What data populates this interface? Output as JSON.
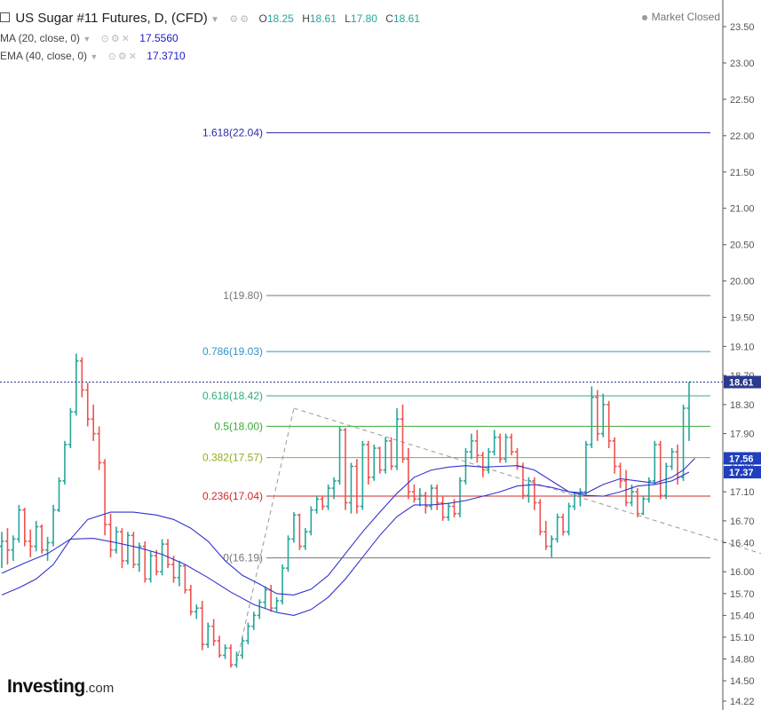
{
  "header": {
    "symbol": "US Sugar #11 Futures, D, (CFD)",
    "o_label": "O",
    "o_val": "18.25",
    "h_label": "H",
    "h_val": "18.61",
    "l_label": "L",
    "l_val": "17.80",
    "c_label": "C",
    "c_val": "18.61",
    "status": "Market Closed"
  },
  "indicators": [
    {
      "name": "MA (20, close, 0)",
      "value": "17.5560",
      "color": "#3333cc"
    },
    {
      "name": "EMA (40, close, 0)",
      "value": "17.3710",
      "color": "#3333cc"
    }
  ],
  "logo": {
    "main": "Investing",
    "suffix": ".com"
  },
  "chart_data": {
    "type": "ohlc",
    "y_axis": {
      "min": 14.2,
      "max": 23.7,
      "ticks": [
        "23.50",
        "23.00",
        "22.50",
        "22.00",
        "21.50",
        "21.00",
        "20.50",
        "20.00",
        "19.50",
        "19.10",
        "18.70",
        "18.30",
        "17.90",
        "17.50",
        "17.10",
        "16.70",
        "16.40",
        "16.00",
        "15.70",
        "15.40",
        "15.10",
        "14.80",
        "14.50",
        "14.22"
      ]
    },
    "price_badges": [
      {
        "label": "18.61",
        "value": 18.61,
        "color": "#2b3a8f"
      },
      {
        "label": "17.56",
        "value": 17.56,
        "color": "#1f3fbf"
      },
      {
        "label": "17.37",
        "value": 17.37,
        "color": "#1f3fbf"
      }
    ],
    "last_price": 18.61,
    "fib_levels": [
      {
        "label": "1.618(22.04)",
        "value": 22.04,
        "color": "#2a2aa8"
      },
      {
        "label": "1(19.80)",
        "value": 19.8,
        "color": "#777777"
      },
      {
        "label": "0.786(19.03)",
        "value": 19.03,
        "color": "#2e96c8"
      },
      {
        "label": "0.618(18.42)",
        "value": 18.42,
        "color": "#2eb07a"
      },
      {
        "label": "0.5(18.00)",
        "value": 18.0,
        "color": "#3aaa3a"
      },
      {
        "label": "0.382(17.57)",
        "value": 17.57,
        "color": "#8fb020"
      },
      {
        "label": "0.236(17.04)",
        "value": 17.04,
        "color": "#cc2a2a"
      },
      {
        "label": "0(16.19)",
        "value": 16.19,
        "color": "#777777"
      }
    ],
    "up_color": "#26a69a",
    "down_color": "#ef5350",
    "ohlc": [
      [
        16.35,
        16.55,
        16.05,
        16.42
      ],
      [
        16.42,
        16.6,
        16.1,
        16.3
      ],
      [
        16.3,
        16.5,
        16.15,
        16.45
      ],
      [
        16.45,
        16.92,
        16.4,
        16.85
      ],
      [
        16.85,
        16.88,
        16.35,
        16.42
      ],
      [
        16.42,
        16.58,
        16.2,
        16.35
      ],
      [
        16.35,
        16.7,
        16.28,
        16.62
      ],
      [
        16.62,
        16.65,
        16.25,
        16.3
      ],
      [
        16.3,
        16.48,
        16.15,
        16.4
      ],
      [
        16.4,
        16.92,
        16.35,
        16.85
      ],
      [
        16.85,
        17.3,
        16.82,
        17.25
      ],
      [
        17.25,
        17.8,
        17.2,
        17.75
      ],
      [
        17.75,
        18.25,
        17.7,
        18.2
      ],
      [
        18.2,
        19.0,
        18.15,
        18.9
      ],
      [
        18.9,
        18.95,
        18.4,
        18.5
      ],
      [
        18.5,
        18.6,
        18.0,
        18.1
      ],
      [
        18.1,
        18.3,
        17.8,
        17.9
      ],
      [
        17.9,
        18.0,
        17.4,
        17.5
      ],
      [
        17.5,
        17.55,
        16.5,
        16.65
      ],
      [
        16.65,
        16.8,
        16.2,
        16.3
      ],
      [
        16.3,
        16.62,
        16.25,
        16.55
      ],
      [
        16.55,
        16.6,
        16.05,
        16.15
      ],
      [
        16.15,
        16.55,
        16.1,
        16.5
      ],
      [
        16.5,
        16.55,
        16.05,
        16.1
      ],
      [
        16.1,
        16.4,
        16.0,
        16.35
      ],
      [
        16.35,
        16.42,
        15.85,
        15.9
      ],
      [
        15.9,
        16.28,
        15.85,
        16.22
      ],
      [
        16.22,
        16.3,
        15.95,
        16.0
      ],
      [
        16.0,
        16.45,
        15.95,
        16.38
      ],
      [
        16.38,
        16.45,
        16.05,
        16.1
      ],
      [
        16.1,
        16.22,
        15.85,
        15.92
      ],
      [
        15.92,
        16.15,
        15.8,
        16.08
      ],
      [
        16.08,
        16.1,
        15.7,
        15.75
      ],
      [
        15.75,
        15.82,
        15.4,
        15.45
      ],
      [
        15.45,
        15.55,
        15.35,
        15.5
      ],
      [
        15.5,
        15.6,
        14.92,
        15.0
      ],
      [
        15.0,
        15.3,
        14.95,
        15.25
      ],
      [
        15.25,
        15.35,
        14.98,
        15.05
      ],
      [
        15.05,
        15.12,
        14.82,
        14.85
      ],
      [
        14.85,
        15.0,
        14.8,
        14.95
      ],
      [
        14.95,
        15.0,
        14.68,
        14.72
      ],
      [
        14.72,
        14.9,
        14.68,
        14.85
      ],
      [
        14.85,
        15.1,
        14.8,
        15.05
      ],
      [
        15.05,
        15.3,
        15.0,
        15.25
      ],
      [
        15.25,
        15.45,
        15.2,
        15.4
      ],
      [
        15.4,
        15.62,
        15.35,
        15.58
      ],
      [
        15.58,
        15.8,
        15.5,
        15.75
      ],
      [
        15.75,
        15.82,
        15.45,
        15.5
      ],
      [
        15.5,
        15.65,
        15.45,
        15.6
      ],
      [
        15.6,
        16.1,
        15.55,
        16.05
      ],
      [
        16.05,
        16.5,
        16.0,
        16.45
      ],
      [
        16.45,
        16.82,
        16.4,
        16.78
      ],
      [
        16.78,
        16.8,
        16.3,
        16.35
      ],
      [
        16.35,
        16.6,
        16.3,
        16.55
      ],
      [
        16.55,
        16.9,
        16.5,
        16.85
      ],
      [
        16.85,
        17.05,
        16.8,
        17.0
      ],
      [
        17.0,
        17.05,
        16.85,
        16.9
      ],
      [
        16.9,
        17.2,
        16.85,
        17.15
      ],
      [
        17.15,
        17.3,
        17.0,
        17.25
      ],
      [
        17.25,
        18.0,
        17.2,
        17.95
      ],
      [
        17.95,
        17.98,
        16.85,
        16.95
      ],
      [
        16.95,
        17.5,
        16.8,
        17.45
      ],
      [
        17.45,
        17.55,
        16.8,
        16.9
      ],
      [
        16.9,
        17.8,
        16.85,
        17.75
      ],
      [
        17.75,
        17.8,
        17.2,
        17.3
      ],
      [
        17.3,
        17.75,
        17.25,
        17.7
      ],
      [
        17.7,
        17.72,
        17.35,
        17.4
      ],
      [
        17.4,
        17.85,
        17.35,
        17.8
      ],
      [
        17.8,
        17.85,
        17.4,
        17.45
      ],
      [
        17.45,
        18.25,
        17.4,
        18.1
      ],
      [
        18.1,
        18.3,
        17.5,
        17.55
      ],
      [
        17.55,
        17.7,
        17.0,
        17.1
      ],
      [
        17.1,
        17.2,
        16.95,
        17.0
      ],
      [
        17.0,
        17.15,
        16.9,
        17.05
      ],
      [
        17.05,
        17.1,
        16.8,
        16.9
      ],
      [
        16.9,
        17.2,
        16.85,
        17.15
      ],
      [
        17.15,
        17.2,
        16.85,
        16.95
      ],
      [
        16.95,
        17.05,
        16.7,
        16.75
      ],
      [
        16.75,
        16.95,
        16.7,
        16.9
      ],
      [
        16.9,
        17.0,
        16.75,
        16.8
      ],
      [
        16.8,
        17.3,
        16.75,
        17.25
      ],
      [
        17.25,
        17.7,
        17.2,
        17.65
      ],
      [
        17.65,
        17.9,
        17.55,
        17.8
      ],
      [
        17.8,
        17.95,
        17.5,
        17.6
      ],
      [
        17.6,
        17.65,
        17.3,
        17.4
      ],
      [
        17.4,
        17.7,
        17.35,
        17.65
      ],
      [
        17.65,
        17.95,
        17.6,
        17.85
      ],
      [
        17.85,
        17.9,
        17.5,
        17.55
      ],
      [
        17.55,
        17.9,
        17.5,
        17.85
      ],
      [
        17.85,
        17.9,
        17.6,
        17.65
      ],
      [
        17.65,
        17.7,
        17.4,
        17.45
      ],
      [
        17.45,
        17.5,
        17.0,
        17.05
      ],
      [
        17.05,
        17.3,
        16.95,
        17.25
      ],
      [
        17.25,
        17.3,
        16.85,
        16.95
      ],
      [
        16.95,
        17.0,
        16.5,
        16.55
      ],
      [
        16.55,
        16.7,
        16.3,
        16.35
      ],
      [
        16.35,
        16.5,
        16.2,
        16.45
      ],
      [
        16.45,
        16.8,
        16.4,
        16.75
      ],
      [
        16.75,
        16.8,
        16.5,
        16.55
      ],
      [
        16.55,
        16.95,
        16.5,
        16.9
      ],
      [
        16.9,
        17.1,
        16.85,
        17.05
      ],
      [
        17.05,
        17.15,
        16.9,
        17.1
      ],
      [
        17.1,
        17.8,
        17.05,
        17.75
      ],
      [
        17.75,
        18.55,
        17.7,
        18.4
      ],
      [
        18.4,
        18.5,
        17.8,
        17.9
      ],
      [
        17.9,
        18.45,
        17.85,
        18.3
      ],
      [
        18.3,
        18.35,
        17.7,
        17.8
      ],
      [
        17.8,
        17.85,
        17.35,
        17.45
      ],
      [
        17.45,
        17.5,
        17.15,
        17.25
      ],
      [
        17.25,
        17.4,
        16.9,
        16.95
      ],
      [
        16.95,
        17.2,
        16.9,
        17.1
      ],
      [
        17.1,
        17.15,
        16.75,
        16.8
      ],
      [
        16.8,
        17.05,
        16.78,
        17.0
      ],
      [
        17.0,
        17.3,
        16.95,
        17.25
      ],
      [
        17.25,
        17.8,
        17.2,
        17.75
      ],
      [
        17.75,
        17.8,
        17.0,
        17.05
      ],
      [
        17.05,
        17.5,
        17.0,
        17.45
      ],
      [
        17.45,
        17.7,
        17.4,
        17.65
      ],
      [
        17.65,
        17.75,
        17.2,
        17.3
      ],
      [
        17.3,
        18.3,
        17.25,
        18.25
      ],
      [
        18.25,
        18.61,
        17.8,
        18.61
      ]
    ],
    "ma20": [
      [
        0,
        15.68
      ],
      [
        3,
        15.78
      ],
      [
        6,
        15.9
      ],
      [
        9,
        16.1
      ],
      [
        12,
        16.45
      ],
      [
        15,
        16.72
      ],
      [
        19,
        16.82
      ],
      [
        23,
        16.82
      ],
      [
        27,
        16.78
      ],
      [
        30,
        16.72
      ],
      [
        33,
        16.6
      ],
      [
        36,
        16.42
      ],
      [
        39,
        16.15
      ],
      [
        42,
        15.95
      ],
      [
        45,
        15.83
      ],
      [
        48,
        15.7
      ],
      [
        51,
        15.68
      ],
      [
        54,
        15.76
      ],
      [
        57,
        15.95
      ],
      [
        60,
        16.25
      ],
      [
        63,
        16.55
      ],
      [
        66,
        16.82
      ],
      [
        69,
        17.08
      ],
      [
        72,
        17.3
      ],
      [
        75,
        17.4
      ],
      [
        78,
        17.44
      ],
      [
        81,
        17.46
      ],
      [
        84,
        17.44
      ],
      [
        87,
        17.45
      ],
      [
        90,
        17.46
      ],
      [
        93,
        17.4
      ],
      [
        96,
        17.25
      ],
      [
        99,
        17.1
      ],
      [
        102,
        17.08
      ],
      [
        105,
        17.2
      ],
      [
        108,
        17.28
      ],
      [
        111,
        17.25
      ],
      [
        114,
        17.22
      ],
      [
        117,
        17.3
      ],
      [
        119,
        17.4
      ],
      [
        121,
        17.56
      ]
    ],
    "ema40": [
      [
        0,
        15.98
      ],
      [
        4,
        16.12
      ],
      [
        8,
        16.25
      ],
      [
        12,
        16.45
      ],
      [
        16,
        16.46
      ],
      [
        20,
        16.4
      ],
      [
        24,
        16.33
      ],
      [
        28,
        16.24
      ],
      [
        32,
        16.1
      ],
      [
        36,
        15.92
      ],
      [
        40,
        15.72
      ],
      [
        44,
        15.55
      ],
      [
        48,
        15.44
      ],
      [
        51,
        15.4
      ],
      [
        54,
        15.48
      ],
      [
        57,
        15.65
      ],
      [
        60,
        15.9
      ],
      [
        63,
        16.2
      ],
      [
        66,
        16.5
      ],
      [
        69,
        16.76
      ],
      [
        72,
        16.92
      ],
      [
        75,
        16.92
      ],
      [
        78,
        16.94
      ],
      [
        81,
        16.98
      ],
      [
        84,
        17.04
      ],
      [
        87,
        17.1
      ],
      [
        90,
        17.18
      ],
      [
        93,
        17.2
      ],
      [
        96,
        17.16
      ],
      [
        99,
        17.1
      ],
      [
        102,
        17.05
      ],
      [
        105,
        17.04
      ],
      [
        108,
        17.1
      ],
      [
        111,
        17.18
      ],
      [
        114,
        17.2
      ],
      [
        117,
        17.25
      ],
      [
        120,
        17.37
      ]
    ],
    "trend_lines": [
      {
        "from": [
          41,
          14.75
        ],
        "to": [
          51,
          18.25
        ]
      },
      {
        "from": [
          51,
          18.25
        ],
        "to": [
          135,
          16.19
        ]
      }
    ]
  }
}
